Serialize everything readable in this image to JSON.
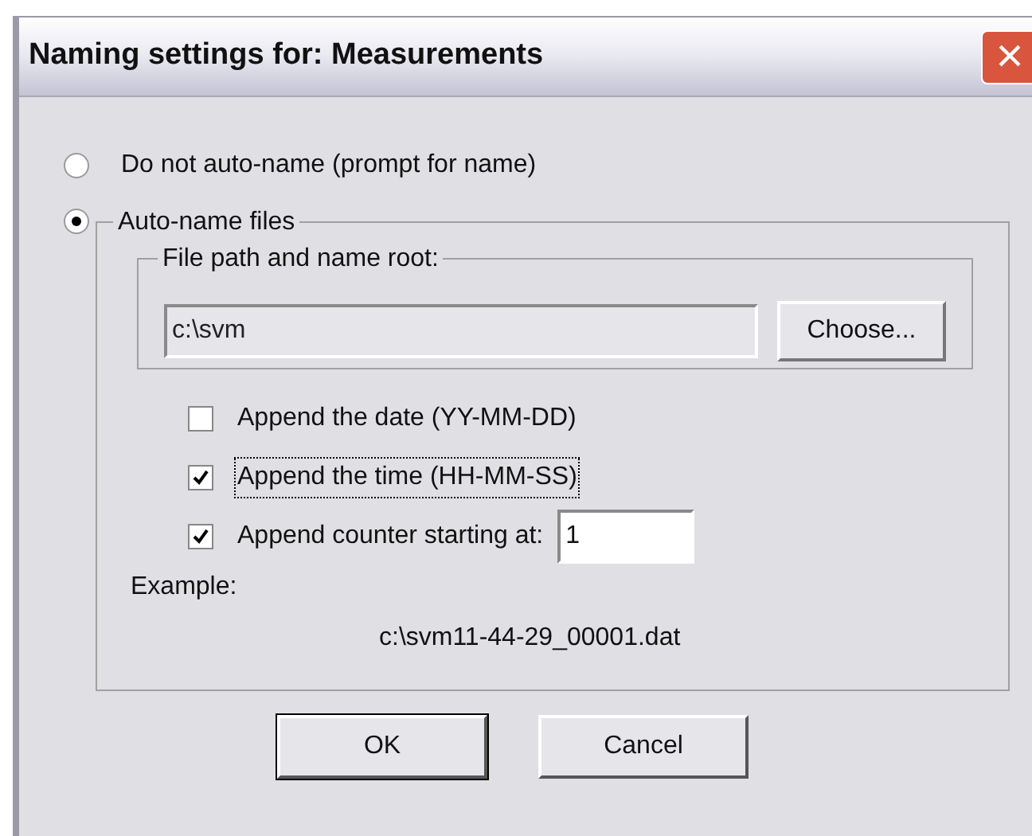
{
  "window": {
    "title": "Naming settings for: Measurements",
    "close": "×"
  },
  "modes": [
    {
      "label": "Do not auto-name (prompt for name)",
      "selected": false
    },
    {
      "label": "Auto-name files",
      "selected": true
    }
  ],
  "path_group": {
    "legend": "File path and name root:",
    "value": "c:\\svm",
    "button": "Choose..."
  },
  "options": [
    {
      "label": "Append the date (YY-MM-DD)",
      "checked": false,
      "focused": false
    },
    {
      "label": "Append the time (HH-MM-SS)",
      "checked": true,
      "focused": true
    },
    {
      "label": "Append counter starting at:",
      "checked": true,
      "focused": false,
      "value": "1"
    }
  ],
  "example": {
    "label": "Example:",
    "value": "c:\\svm11-44-29_00001.dat"
  },
  "buttons": [
    {
      "label": "OK",
      "default": true
    },
    {
      "label": "Cancel",
      "default": false
    }
  ]
}
